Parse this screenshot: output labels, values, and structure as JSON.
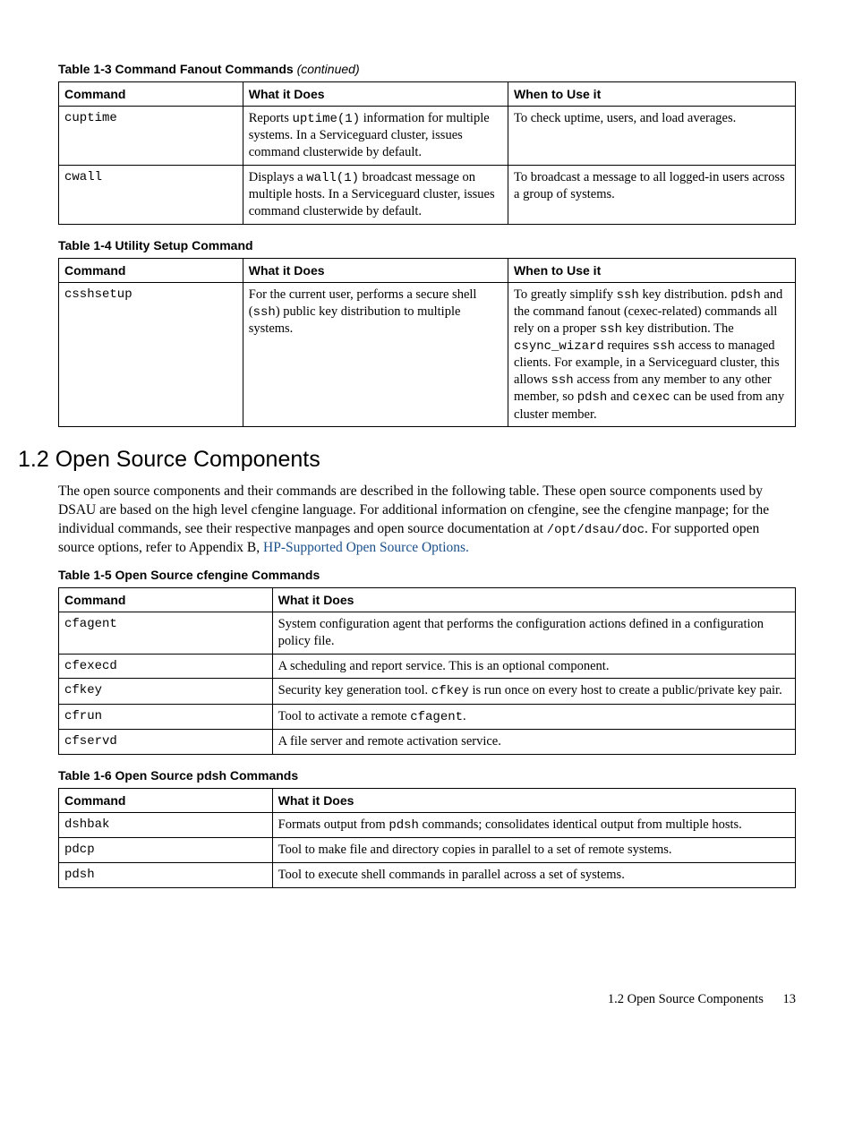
{
  "table13": {
    "caption_main": "Table 1-3 Command Fanout Commands",
    "caption_suffix": "(continued)",
    "headers": {
      "c1": "Command",
      "c2": "What it Does",
      "c3": "When to Use it"
    },
    "rows": {
      "r0": {
        "cmd": "cuptime",
        "what_a": "Reports ",
        "what_code": "uptime(1)",
        "what_b": " information for multiple systems. In a Serviceguard cluster, issues command clusterwide by default.",
        "when": "To check uptime, users, and load averages."
      },
      "r1": {
        "cmd": "cwall",
        "what_a": "Displays a ",
        "what_code": "wall(1)",
        "what_b": " broadcast message on multiple hosts. In a Serviceguard cluster, issues command clusterwide by default.",
        "when": "To broadcast a message to all logged-in users across a group of systems."
      }
    }
  },
  "table14": {
    "caption": "Table 1-4 Utility Setup Command",
    "headers": {
      "c1": "Command",
      "c2": "What it Does",
      "c3": "When to Use it"
    },
    "rows": {
      "r0": {
        "cmd": "csshsetup",
        "what_a": "For the current user, performs a secure shell (",
        "what_code": "ssh",
        "what_b": ") public key distribution to multiple systems.",
        "when_1a": "To greatly simplify ",
        "when_1code": "ssh",
        "when_1b": " key distribution. ",
        "when_2code": "pdsh",
        "when_2a": " and the command fanout (cexec-related) commands all rely on a proper ",
        "when_2code2": "ssh",
        "when_2b": " key distribution. The ",
        "when_3code": "csync_wizard",
        "when_3a": " requires ",
        "when_3code2": "ssh",
        "when_3b": " access to managed clients. For example, in a Serviceguard cluster, this allows ",
        "when_4code": "ssh",
        "when_4a": " access from any member to any other member, so ",
        "when_5code": "pdsh",
        "when_5a": " and ",
        "when_5code2": "cexec",
        "when_5b": " can be used from any cluster member."
      }
    }
  },
  "section12": {
    "heading": "1.2 Open Source Components",
    "para_a": "The open source components and their commands are described in the following table. These open source components used by DSAU are based on the high level cfengine language. For additional information on cfengine, see the cfengine manpage; for the individual commands, see their respective manpages and open source documentation at ",
    "para_path": "/opt/dsau/doc",
    "para_b": ". For supported open source options, refer to Appendix B, ",
    "para_link": "HP-Supported Open Source Options.",
    "para_c": ""
  },
  "table15": {
    "caption": "Table 1-5 Open Source cfengine Commands",
    "headers": {
      "c1": "Command",
      "c2": "What it Does"
    },
    "rows": {
      "r0": {
        "cmd": "cfagent",
        "what": "System configuration agent that performs the configuration actions defined in a configuration policy file."
      },
      "r1": {
        "cmd": "cfexecd",
        "what": "A scheduling and report service. This is an optional component."
      },
      "r2": {
        "cmd": "cfkey",
        "what_a": "Security key generation tool. ",
        "code": "cfkey",
        "what_b": " is run once on every host to create a public/private key pair."
      },
      "r3": {
        "cmd": "cfrun",
        "what_a": "Tool to activate a remote ",
        "code": "cfagent",
        "what_b": "."
      },
      "r4": {
        "cmd": "cfservd",
        "what": "A file server and remote activation service."
      }
    }
  },
  "table16": {
    "caption": "Table 1-6 Open Source pdsh Commands",
    "headers": {
      "c1": "Command",
      "c2": "What it Does"
    },
    "rows": {
      "r0": {
        "cmd": "dshbak",
        "what_a": "Formats output from ",
        "code": "pdsh",
        "what_b": " commands; consolidates identical output from multiple hosts."
      },
      "r1": {
        "cmd": "pdcp",
        "what": "Tool to make file and directory copies in parallel to a set of remote systems."
      },
      "r2": {
        "cmd": "pdsh",
        "what": "Tool to execute shell commands in parallel across a set of systems."
      }
    }
  },
  "footer": {
    "text": "1.2 Open Source Components",
    "page": "13"
  }
}
